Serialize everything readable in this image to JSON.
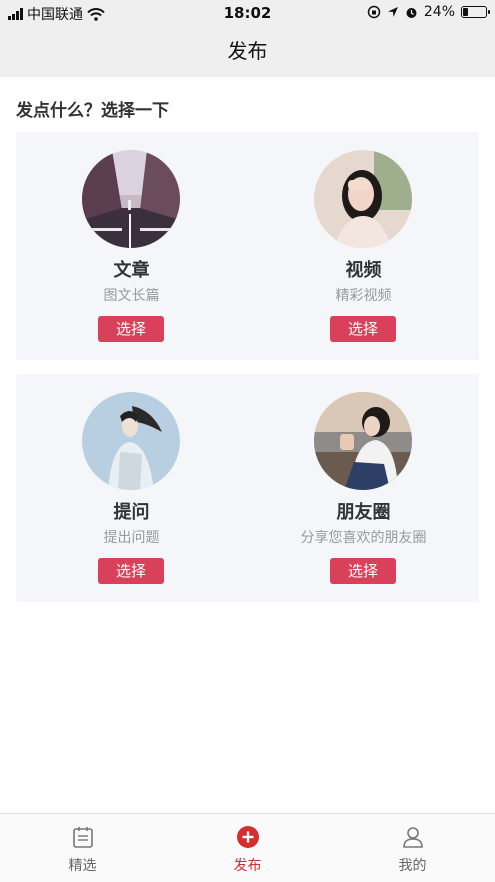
{
  "status_bar": {
    "carrier": "中国联通",
    "time": "18:02",
    "battery": "24%",
    "battery_level": 0.24
  },
  "header": {
    "title": "发布"
  },
  "prompt": "发点什么？选择一下",
  "options": [
    {
      "title": "文章",
      "subtitle": "图文长篇",
      "button": "选择"
    },
    {
      "title": "视频",
      "subtitle": "精彩视频",
      "button": "选择"
    },
    {
      "title": "提问",
      "subtitle": "提出问题",
      "button": "选择"
    },
    {
      "title": "朋友圈",
      "subtitle": "分享您喜欢的朋友圈",
      "button": "选择"
    }
  ],
  "tabbar": {
    "items": [
      {
        "label": "精选",
        "icon": "calendar-icon"
      },
      {
        "label": "发布",
        "icon": "plus-circle-icon",
        "active": true
      },
      {
        "label": "我的",
        "icon": "user-icon"
      }
    ],
    "accent": "#d32f2f"
  },
  "colors": {
    "button": "#d9415a",
    "panel": "#f4f6f9",
    "bar": "#efefef"
  }
}
